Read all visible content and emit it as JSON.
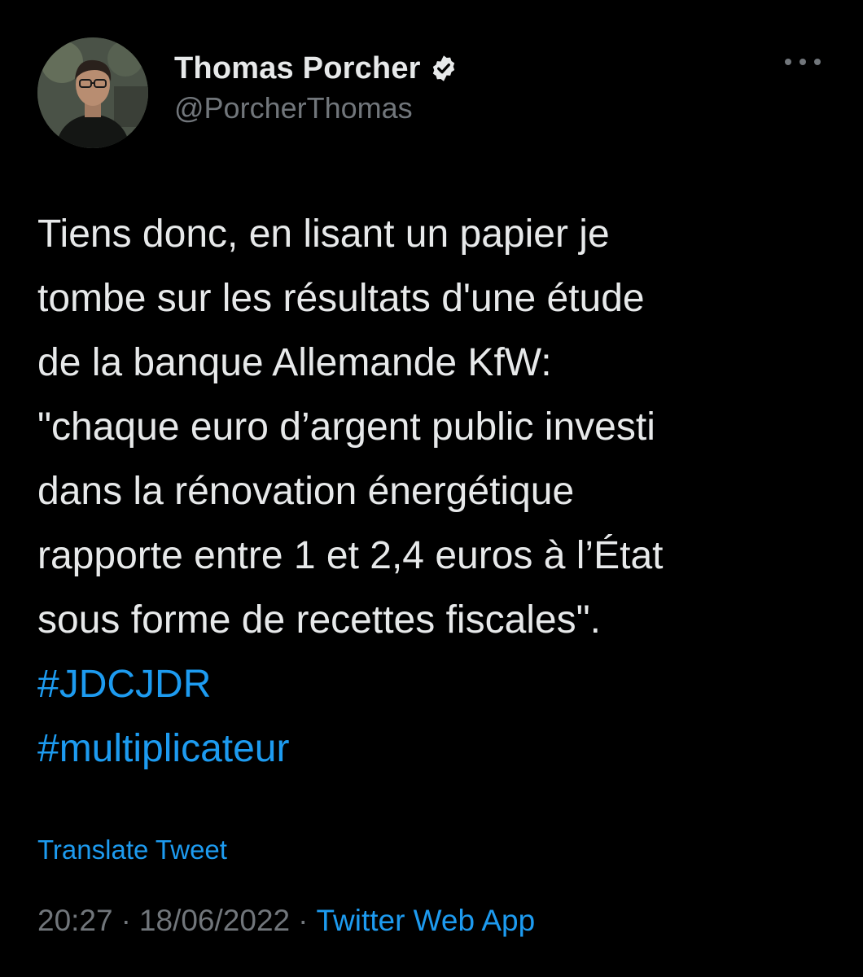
{
  "author": {
    "display_name": "Thomas Porcher",
    "handle": "@PorcherThomas",
    "verified_icon": "verified-badge-icon"
  },
  "menu": {
    "icon": "more-horizontal-icon"
  },
  "tweet": {
    "lines": [
      "Tiens donc, en lisant un papier je",
      "tombe sur les résultats d'une étude",
      "de la banque Allemande KfW:",
      "\"chaque euro d’argent public investi",
      "dans la rénovation énergétique",
      "rapporte entre 1 et 2,4 euros à l’État",
      "sous forme de recettes fiscales\"."
    ],
    "hashtags": [
      "#JDCJDR",
      "#multiplicateur"
    ]
  },
  "translate_label": "Translate Tweet",
  "meta": {
    "time": "20:27",
    "separator": "·",
    "date": "18/06/2022",
    "source": "Twitter Web App"
  },
  "colors": {
    "background": "#000000",
    "text": "#e7e9ea",
    "secondary": "#71767b",
    "accent": "#1d9bf0"
  }
}
